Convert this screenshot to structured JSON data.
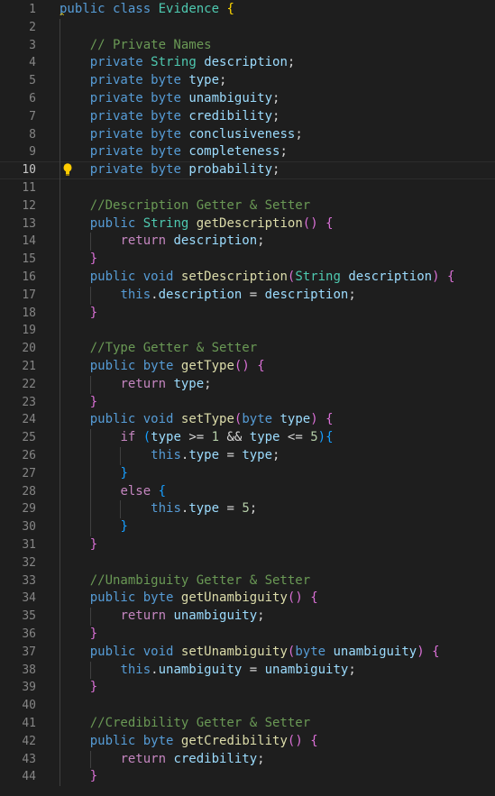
{
  "editor": {
    "current_line": 10,
    "lines": [
      {
        "n": "1",
        "tokens": [
          [
            "keyword",
            "public"
          ],
          [
            "plain",
            " "
          ],
          [
            "keyword",
            "class"
          ],
          [
            "plain",
            " "
          ],
          [
            "type",
            "Evidence"
          ],
          [
            "plain",
            " "
          ],
          [
            "b1",
            "{"
          ]
        ]
      },
      {
        "n": "2",
        "tokens": []
      },
      {
        "n": "3",
        "tokens": [
          [
            "plain",
            "    "
          ],
          [
            "comment",
            "// Private Names"
          ]
        ]
      },
      {
        "n": "4",
        "tokens": [
          [
            "plain",
            "    "
          ],
          [
            "keyword",
            "private"
          ],
          [
            "plain",
            " "
          ],
          [
            "type",
            "String"
          ],
          [
            "plain",
            " "
          ],
          [
            "ident",
            "description"
          ],
          [
            "punct",
            ";"
          ]
        ]
      },
      {
        "n": "5",
        "tokens": [
          [
            "plain",
            "    "
          ],
          [
            "keyword",
            "private"
          ],
          [
            "plain",
            " "
          ],
          [
            "keyword",
            "byte"
          ],
          [
            "plain",
            " "
          ],
          [
            "ident",
            "type"
          ],
          [
            "punct",
            ";"
          ]
        ]
      },
      {
        "n": "6",
        "tokens": [
          [
            "plain",
            "    "
          ],
          [
            "keyword",
            "private"
          ],
          [
            "plain",
            " "
          ],
          [
            "keyword",
            "byte"
          ],
          [
            "plain",
            " "
          ],
          [
            "ident",
            "unambiguity"
          ],
          [
            "punct",
            ";"
          ]
        ]
      },
      {
        "n": "7",
        "tokens": [
          [
            "plain",
            "    "
          ],
          [
            "keyword",
            "private"
          ],
          [
            "plain",
            " "
          ],
          [
            "keyword",
            "byte"
          ],
          [
            "plain",
            " "
          ],
          [
            "ident",
            "credibility"
          ],
          [
            "punct",
            ";"
          ]
        ]
      },
      {
        "n": "8",
        "tokens": [
          [
            "plain",
            "    "
          ],
          [
            "keyword",
            "private"
          ],
          [
            "plain",
            " "
          ],
          [
            "keyword",
            "byte"
          ],
          [
            "plain",
            " "
          ],
          [
            "ident",
            "conclusiveness"
          ],
          [
            "punct",
            ";"
          ]
        ]
      },
      {
        "n": "9",
        "tokens": [
          [
            "plain",
            "    "
          ],
          [
            "keyword",
            "private"
          ],
          [
            "plain",
            " "
          ],
          [
            "keyword",
            "byte"
          ],
          [
            "plain",
            " "
          ],
          [
            "ident",
            "completeness"
          ],
          [
            "punct",
            ";"
          ]
        ]
      },
      {
        "n": "10",
        "tokens": [
          [
            "plain",
            "    "
          ],
          [
            "keyword",
            "private"
          ],
          [
            "plain",
            " "
          ],
          [
            "keyword",
            "byte"
          ],
          [
            "plain",
            " "
          ],
          [
            "ident",
            "probability"
          ],
          [
            "punct",
            ";"
          ]
        ]
      },
      {
        "n": "11",
        "tokens": []
      },
      {
        "n": "12",
        "tokens": [
          [
            "plain",
            "    "
          ],
          [
            "comment",
            "//Description Getter & Setter"
          ]
        ]
      },
      {
        "n": "13",
        "tokens": [
          [
            "plain",
            "    "
          ],
          [
            "keyword",
            "public"
          ],
          [
            "plain",
            " "
          ],
          [
            "type",
            "String"
          ],
          [
            "plain",
            " "
          ],
          [
            "func",
            "getDescription"
          ],
          [
            "b2",
            "()"
          ],
          [
            "plain",
            " "
          ],
          [
            "b2",
            "{"
          ]
        ]
      },
      {
        "n": "14",
        "tokens": [
          [
            "plain",
            "        "
          ],
          [
            "control",
            "return"
          ],
          [
            "plain",
            " "
          ],
          [
            "ident",
            "description"
          ],
          [
            "punct",
            ";"
          ]
        ]
      },
      {
        "n": "15",
        "tokens": [
          [
            "plain",
            "    "
          ],
          [
            "b2",
            "}"
          ]
        ]
      },
      {
        "n": "16",
        "tokens": [
          [
            "plain",
            "    "
          ],
          [
            "keyword",
            "public"
          ],
          [
            "plain",
            " "
          ],
          [
            "keyword",
            "void"
          ],
          [
            "plain",
            " "
          ],
          [
            "func",
            "setDescription"
          ],
          [
            "b2",
            "("
          ],
          [
            "type",
            "String"
          ],
          [
            "plain",
            " "
          ],
          [
            "ident",
            "description"
          ],
          [
            "b2",
            ")"
          ],
          [
            "plain",
            " "
          ],
          [
            "b2",
            "{"
          ]
        ]
      },
      {
        "n": "17",
        "tokens": [
          [
            "plain",
            "        "
          ],
          [
            "keyword",
            "this"
          ],
          [
            "punct",
            "."
          ],
          [
            "ident",
            "description"
          ],
          [
            "plain",
            " = "
          ],
          [
            "ident",
            "description"
          ],
          [
            "punct",
            ";"
          ]
        ]
      },
      {
        "n": "18",
        "tokens": [
          [
            "plain",
            "    "
          ],
          [
            "b2",
            "}"
          ]
        ]
      },
      {
        "n": "19",
        "tokens": []
      },
      {
        "n": "20",
        "tokens": [
          [
            "plain",
            "    "
          ],
          [
            "comment",
            "//Type Getter & Setter"
          ]
        ]
      },
      {
        "n": "21",
        "tokens": [
          [
            "plain",
            "    "
          ],
          [
            "keyword",
            "public"
          ],
          [
            "plain",
            " "
          ],
          [
            "keyword",
            "byte"
          ],
          [
            "plain",
            " "
          ],
          [
            "func",
            "getType"
          ],
          [
            "b2",
            "()"
          ],
          [
            "plain",
            " "
          ],
          [
            "b2",
            "{"
          ]
        ]
      },
      {
        "n": "22",
        "tokens": [
          [
            "plain",
            "        "
          ],
          [
            "control",
            "return"
          ],
          [
            "plain",
            " "
          ],
          [
            "ident",
            "type"
          ],
          [
            "punct",
            ";"
          ]
        ]
      },
      {
        "n": "23",
        "tokens": [
          [
            "plain",
            "    "
          ],
          [
            "b2",
            "}"
          ]
        ]
      },
      {
        "n": "24",
        "tokens": [
          [
            "plain",
            "    "
          ],
          [
            "keyword",
            "public"
          ],
          [
            "plain",
            " "
          ],
          [
            "keyword",
            "void"
          ],
          [
            "plain",
            " "
          ],
          [
            "func",
            "setType"
          ],
          [
            "b2",
            "("
          ],
          [
            "keyword",
            "byte"
          ],
          [
            "plain",
            " "
          ],
          [
            "ident",
            "type"
          ],
          [
            "b2",
            ")"
          ],
          [
            "plain",
            " "
          ],
          [
            "b2",
            "{"
          ]
        ]
      },
      {
        "n": "25",
        "tokens": [
          [
            "plain",
            "        "
          ],
          [
            "control",
            "if"
          ],
          [
            "plain",
            " "
          ],
          [
            "b3",
            "("
          ],
          [
            "ident",
            "type"
          ],
          [
            "plain",
            " >= "
          ],
          [
            "num",
            "1"
          ],
          [
            "plain",
            " && "
          ],
          [
            "ident",
            "type"
          ],
          [
            "plain",
            " <= "
          ],
          [
            "num",
            "5"
          ],
          [
            "b3",
            ")"
          ],
          [
            "b3",
            "{"
          ]
        ]
      },
      {
        "n": "26",
        "tokens": [
          [
            "plain",
            "            "
          ],
          [
            "keyword",
            "this"
          ],
          [
            "punct",
            "."
          ],
          [
            "ident",
            "type"
          ],
          [
            "plain",
            " = "
          ],
          [
            "ident",
            "type"
          ],
          [
            "punct",
            ";"
          ]
        ]
      },
      {
        "n": "27",
        "tokens": [
          [
            "plain",
            "        "
          ],
          [
            "b3",
            "}"
          ]
        ]
      },
      {
        "n": "28",
        "tokens": [
          [
            "plain",
            "        "
          ],
          [
            "control",
            "else"
          ],
          [
            "plain",
            " "
          ],
          [
            "b3",
            "{"
          ]
        ]
      },
      {
        "n": "29",
        "tokens": [
          [
            "plain",
            "            "
          ],
          [
            "keyword",
            "this"
          ],
          [
            "punct",
            "."
          ],
          [
            "ident",
            "type"
          ],
          [
            "plain",
            " = "
          ],
          [
            "num",
            "5"
          ],
          [
            "punct",
            ";"
          ]
        ]
      },
      {
        "n": "30",
        "tokens": [
          [
            "plain",
            "        "
          ],
          [
            "b3",
            "}"
          ]
        ]
      },
      {
        "n": "31",
        "tokens": [
          [
            "plain",
            "    "
          ],
          [
            "b2",
            "}"
          ]
        ]
      },
      {
        "n": "32",
        "tokens": []
      },
      {
        "n": "33",
        "tokens": [
          [
            "plain",
            "    "
          ],
          [
            "comment",
            "//Unambiguity Getter & Setter"
          ]
        ]
      },
      {
        "n": "34",
        "tokens": [
          [
            "plain",
            "    "
          ],
          [
            "keyword",
            "public"
          ],
          [
            "plain",
            " "
          ],
          [
            "keyword",
            "byte"
          ],
          [
            "plain",
            " "
          ],
          [
            "func",
            "getUnambiguity"
          ],
          [
            "b2",
            "()"
          ],
          [
            "plain",
            " "
          ],
          [
            "b2",
            "{"
          ]
        ]
      },
      {
        "n": "35",
        "tokens": [
          [
            "plain",
            "        "
          ],
          [
            "control",
            "return"
          ],
          [
            "plain",
            " "
          ],
          [
            "ident",
            "unambiguity"
          ],
          [
            "punct",
            ";"
          ]
        ]
      },
      {
        "n": "36",
        "tokens": [
          [
            "plain",
            "    "
          ],
          [
            "b2",
            "}"
          ]
        ]
      },
      {
        "n": "37",
        "tokens": [
          [
            "plain",
            "    "
          ],
          [
            "keyword",
            "public"
          ],
          [
            "plain",
            " "
          ],
          [
            "keyword",
            "void"
          ],
          [
            "plain",
            " "
          ],
          [
            "func",
            "setUnambiguity"
          ],
          [
            "b2",
            "("
          ],
          [
            "keyword",
            "byte"
          ],
          [
            "plain",
            " "
          ],
          [
            "ident",
            "unambiguity"
          ],
          [
            "b2",
            ")"
          ],
          [
            "plain",
            " "
          ],
          [
            "b2",
            "{"
          ]
        ]
      },
      {
        "n": "38",
        "tokens": [
          [
            "plain",
            "        "
          ],
          [
            "keyword",
            "this"
          ],
          [
            "punct",
            "."
          ],
          [
            "ident",
            "unambiguity"
          ],
          [
            "plain",
            " = "
          ],
          [
            "ident",
            "unambiguity"
          ],
          [
            "punct",
            ";"
          ]
        ]
      },
      {
        "n": "39",
        "tokens": [
          [
            "plain",
            "    "
          ],
          [
            "b2",
            "}"
          ]
        ]
      },
      {
        "n": "40",
        "tokens": []
      },
      {
        "n": "41",
        "tokens": [
          [
            "plain",
            "    "
          ],
          [
            "comment",
            "//Credibility Getter & Setter"
          ]
        ]
      },
      {
        "n": "42",
        "tokens": [
          [
            "plain",
            "    "
          ],
          [
            "keyword",
            "public"
          ],
          [
            "plain",
            " "
          ],
          [
            "keyword",
            "byte"
          ],
          [
            "plain",
            " "
          ],
          [
            "func",
            "getCredibility"
          ],
          [
            "b2",
            "()"
          ],
          [
            "plain",
            " "
          ],
          [
            "b2",
            "{"
          ]
        ]
      },
      {
        "n": "43",
        "tokens": [
          [
            "plain",
            "        "
          ],
          [
            "control",
            "return"
          ],
          [
            "plain",
            " "
          ],
          [
            "ident",
            "credibility"
          ],
          [
            "punct",
            ";"
          ]
        ]
      },
      {
        "n": "44",
        "tokens": [
          [
            "plain",
            "    "
          ],
          [
            "b2",
            "}"
          ]
        ]
      }
    ]
  },
  "colors": {
    "background": "#1e1e1e",
    "line_number": "#858585",
    "keyword": "#569cd6",
    "control": "#c586c0",
    "type": "#4ec9b0",
    "identifier": "#9cdcfe",
    "function": "#dcdcaa",
    "comment": "#6a9955",
    "number": "#b5cea8",
    "bracket_level_1": "#ffd700",
    "bracket_level_2": "#da70d6",
    "bracket_level_3": "#179fff"
  },
  "icons": {
    "lightbulb": "lightbulb-icon"
  }
}
